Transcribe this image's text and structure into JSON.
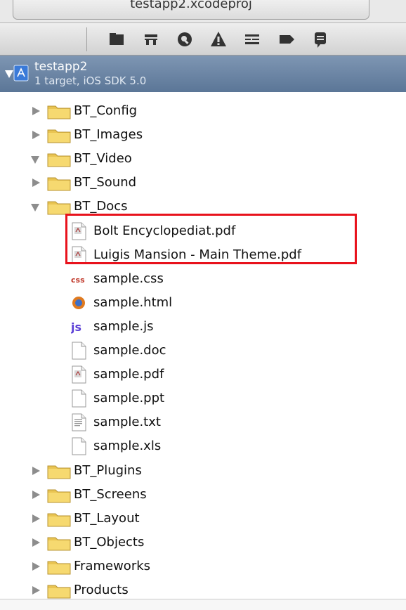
{
  "window": {
    "title": "testapp2.xcodeproj"
  },
  "toolbar": {
    "icons": [
      "project-navigator-icon",
      "symbol-navigator-icon",
      "search-navigator-icon",
      "issue-navigator-icon",
      "debug-navigator-icon",
      "breakpoint-navigator-icon",
      "log-navigator-icon"
    ]
  },
  "project": {
    "name": "testapp2",
    "subtitle": "1 target, iOS SDK 5.0"
  },
  "tree": {
    "items": [
      {
        "label": "BT_Config",
        "kind": "folder",
        "expanded": false
      },
      {
        "label": "BT_Images",
        "kind": "folder",
        "expanded": false
      },
      {
        "label": "BT_Video",
        "kind": "folder",
        "expanded": true
      },
      {
        "label": "BT_Sound",
        "kind": "folder",
        "expanded": false
      },
      {
        "label": "BT_Docs",
        "kind": "folder",
        "expanded": true
      },
      {
        "label": "Bolt Encyclopediat.pdf",
        "kind": "pdf"
      },
      {
        "label": "Luigis Mansion - Main Theme.pdf",
        "kind": "pdf"
      },
      {
        "label": "sample.css",
        "kind": "css"
      },
      {
        "label": "sample.html",
        "kind": "html"
      },
      {
        "label": "sample.js",
        "kind": "js"
      },
      {
        "label": "sample.doc",
        "kind": "blank"
      },
      {
        "label": "sample.pdf",
        "kind": "pdf"
      },
      {
        "label": "sample.ppt",
        "kind": "blank"
      },
      {
        "label": "sample.txt",
        "kind": "txt"
      },
      {
        "label": "sample.xls",
        "kind": "blank"
      },
      {
        "label": "BT_Plugins",
        "kind": "folder",
        "expanded": false
      },
      {
        "label": "BT_Screens",
        "kind": "folder",
        "expanded": false
      },
      {
        "label": "BT_Layout",
        "kind": "folder",
        "expanded": false
      },
      {
        "label": "BT_Objects",
        "kind": "folder",
        "expanded": false
      },
      {
        "label": "Frameworks",
        "kind": "folder",
        "expanded": false
      },
      {
        "label": "Products",
        "kind": "folder",
        "expanded": false
      }
    ]
  },
  "colors": {
    "project_row": "#6a84a5",
    "highlight": "#e8121c",
    "folder": "#f2d36b"
  }
}
